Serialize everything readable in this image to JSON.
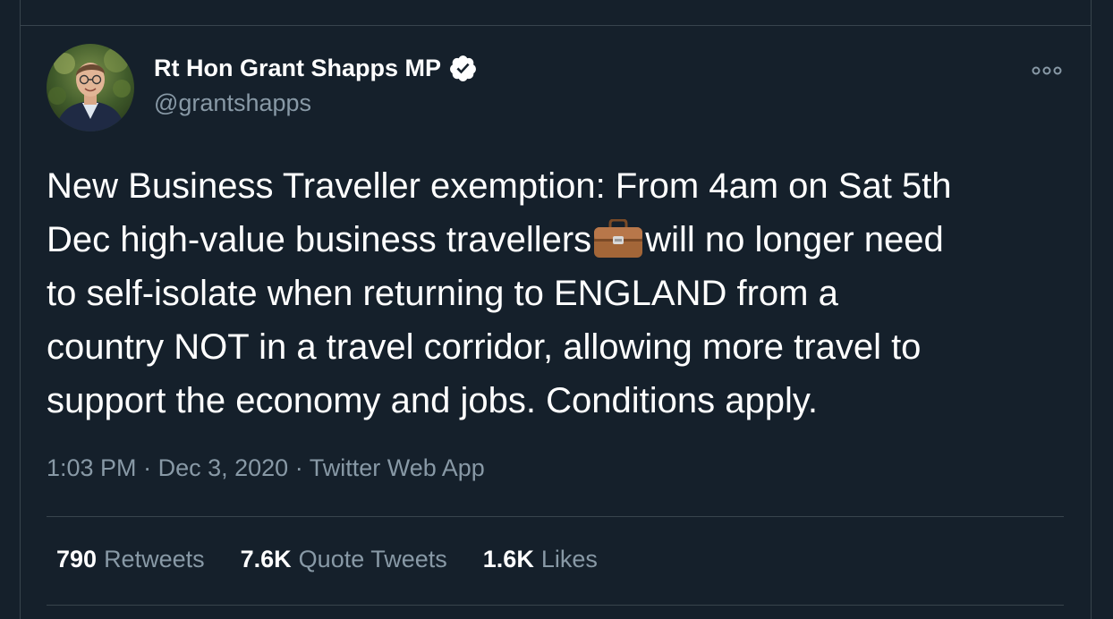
{
  "author": {
    "display_name": "Rt Hon Grant Shapps MP",
    "handle": "@grantshapps",
    "verified": true
  },
  "tweet": {
    "lines": [
      "New Business Traveller exemption: From 4am on Sat 5th",
      "Dec high-value business travellers",
      "will no longer need",
      "to self-isolate when returning to ENGLAND from a",
      "country NOT in a travel corridor, allowing more travel to",
      "support the economy and jobs. Conditions apply."
    ],
    "emoji": "briefcase-icon"
  },
  "meta": {
    "time": "1:03 PM",
    "separator": "·",
    "date": "Dec 3, 2020",
    "source": "Twitter Web App"
  },
  "stats": {
    "retweets_count": "790",
    "retweets_label": "Retweets",
    "quotes_count": "7.6K",
    "quotes_label": "Quote Tweets",
    "likes_count": "1.6K",
    "likes_label": "Likes"
  },
  "colors": {
    "background": "#15202b",
    "border": "#38444d",
    "secondary_text": "#8899a6",
    "primary_text": "#ffffff",
    "verified_badge": "#ffffff"
  }
}
